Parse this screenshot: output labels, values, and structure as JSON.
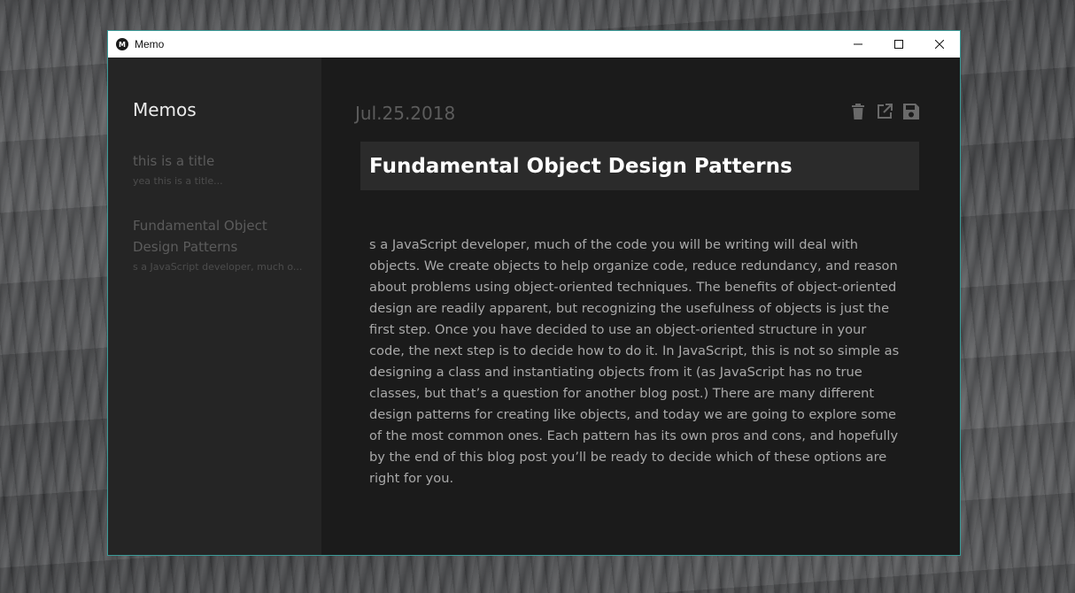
{
  "window": {
    "title": "Memo",
    "icon_letter": "M",
    "controls": [
      "minimize-icon",
      "maximize-icon",
      "close-icon"
    ]
  },
  "sidebar": {
    "heading": "Memos",
    "items": [
      {
        "title": "this is a title",
        "snippet": "yea this is a title..."
      },
      {
        "title": "Fundamental Object Design Patterns",
        "snippet": "s a JavaScript developer, much o..."
      }
    ]
  },
  "editor": {
    "date": "Jul.25.2018",
    "toolbar": [
      "trash-icon",
      "open-external-icon",
      "save-icon"
    ],
    "title": "Fundamental Object Design Patterns",
    "body": "s a JavaScript developer, much of the code you will be writing will deal with objects. We create objects to help organize code, reduce redundancy, and reason about problems using object-oriented techniques. The benefits of object-oriented design are readily apparent, but recognizing the usefulness of objects is just the first step. Once you have decided to use an object-oriented structure in your code, the next step is to decide how to do it. In JavaScript, this is not so simple as designing a class and instantiating objects from it (as JavaScript has no true classes, but that’s a question for another blog post.) There are many different design patterns for creating like objects, and today we are going to explore some of the most common ones. Each pattern has its own pros and cons, and hopefully by the end of this blog post you’ll be ready to decide which of these options are right for you."
  },
  "colors": {
    "window_border": "#3a9a98",
    "sidebar_bg": "#252525",
    "main_bg": "#1b1b1b",
    "title_field_bg": "#2b2b2b"
  }
}
